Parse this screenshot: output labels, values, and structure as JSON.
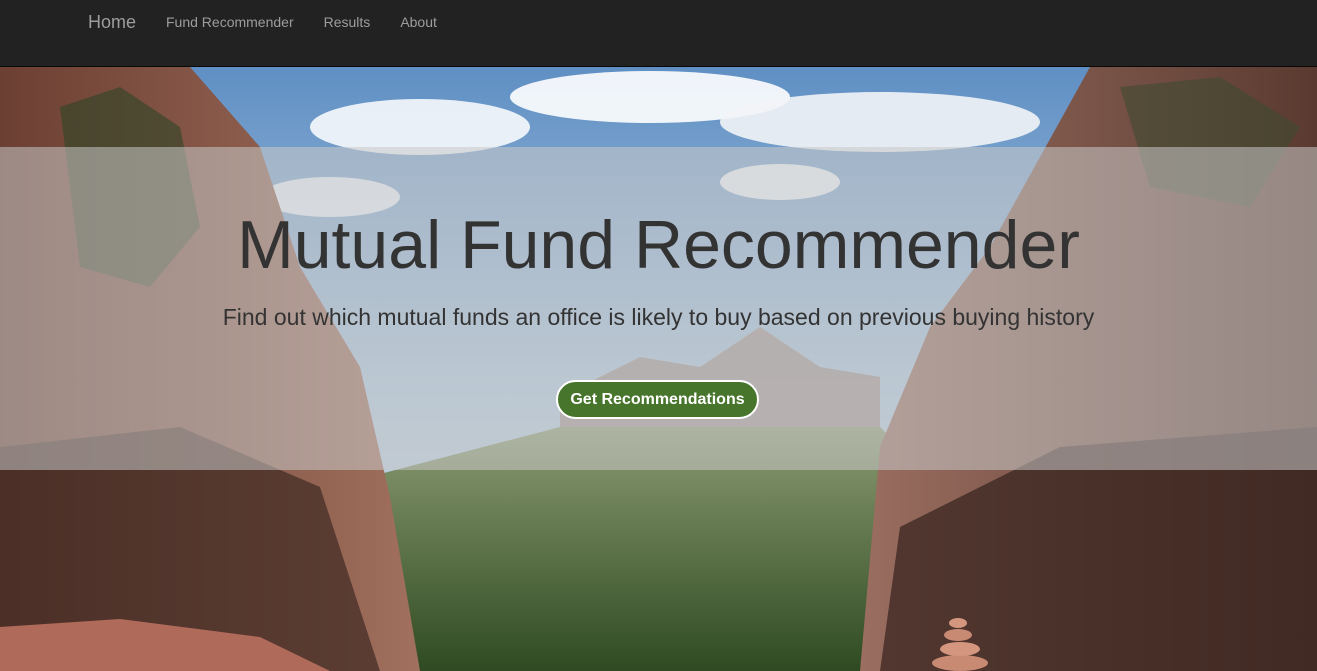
{
  "navbar": {
    "brand": "Home",
    "links": [
      {
        "label": "Fund Recommender"
      },
      {
        "label": "Results"
      },
      {
        "label": "About"
      }
    ]
  },
  "hero": {
    "title": "Mutual Fund Recommender",
    "subtitle": "Find out which mutual funds an office is likely to buy based on previous buying history",
    "cta_label": "Get Recommendations"
  },
  "colors": {
    "navbar_bg": "#222222",
    "nav_text": "#9d9d9d",
    "cta_bg": "#48752c",
    "heading_text": "#333333"
  }
}
